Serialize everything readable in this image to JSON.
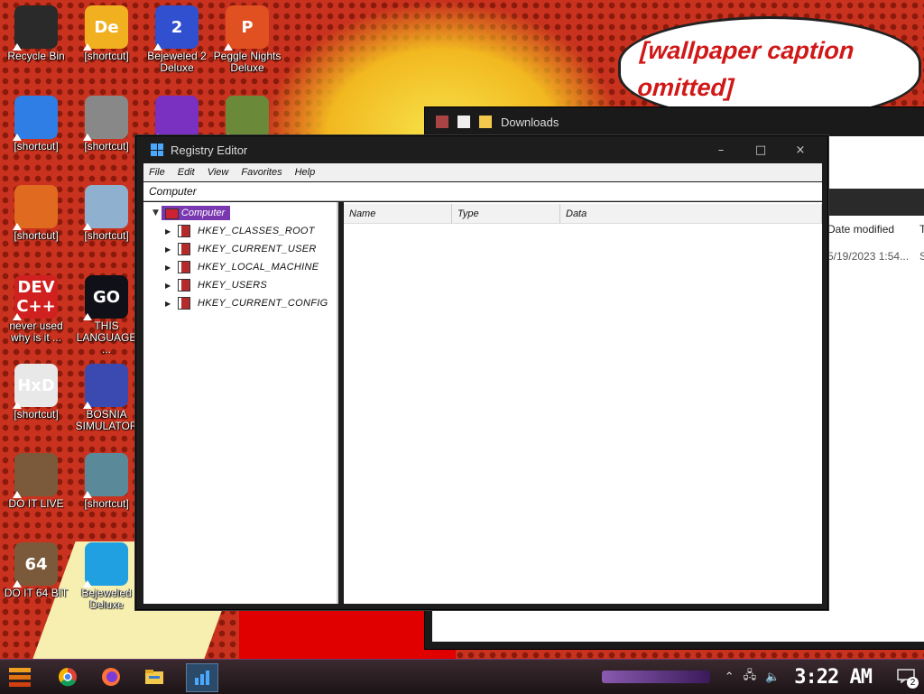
{
  "wallpaper": {
    "bubble_text": "[wallpaper caption omitted]"
  },
  "desktop_icons": [
    {
      "label": "Recycle Bin",
      "glyph": "",
      "color": "#2a2a2a",
      "icon": "recycle-bin-icon"
    },
    {
      "label": "[shortcut]",
      "glyph": "De",
      "color": "#f0b020",
      "icon": "app-de-icon"
    },
    {
      "label": "Bejeweled 2 Deluxe",
      "glyph": "2",
      "color": "#3050d0",
      "icon": "bejeweled-2-icon"
    },
    {
      "label": "Peggle Nights Deluxe",
      "glyph": "P",
      "color": "#e05020",
      "icon": "peggle-icon"
    },
    {
      "label": "[shortcut]",
      "glyph": "",
      "color": "#2f7ee6",
      "icon": "chrome-icon"
    },
    {
      "label": "[shortcut]",
      "glyph": "",
      "color": "#888888",
      "icon": "windows-shortcut-icon"
    },
    {
      "label": "",
      "glyph": "",
      "color": "#7a30c0",
      "icon": "gem-icon"
    },
    {
      "label": "",
      "glyph": "",
      "color": "#6a8a3a",
      "icon": "plants-icon"
    },
    {
      "label": "[shortcut]",
      "glyph": "",
      "color": "#e06a20",
      "icon": "firefox-icon"
    },
    {
      "label": "[shortcut]",
      "glyph": "",
      "color": "#90b0d0",
      "icon": "network-icon"
    },
    {
      "label": "never used why is it ...",
      "glyph": "DEV C++",
      "color": "#d02020",
      "icon": "devcpp-icon"
    },
    {
      "label": "THIS LANGUAGE ...",
      "glyph": "GO",
      "color": "#101018",
      "icon": "goland-icon"
    },
    {
      "label": "[shortcut]",
      "glyph": "HxD",
      "color": "#e8e8e8",
      "icon": "hxd-icon"
    },
    {
      "label": "BOSNIA SIMULATOR",
      "glyph": "",
      "color": "#3a4ab0",
      "icon": "mine-icon"
    },
    {
      "label": "DO IT LIVE",
      "glyph": "",
      "color": "#7a5a3a",
      "icon": "portrait-icon"
    },
    {
      "label": "[shortcut]",
      "glyph": "",
      "color": "#5a8a9a",
      "icon": "elf-icon"
    },
    {
      "label": "DO IT 64 BIT",
      "glyph": "64",
      "color": "#7a5a3a",
      "icon": "portrait-64-icon"
    },
    {
      "label": "Bejeweled Deluxe",
      "glyph": "",
      "color": "#20a0e0",
      "icon": "diamond-icon"
    }
  ],
  "explorer": {
    "title": "Downloads",
    "col_date": "Date modified",
    "col_type": "T",
    "row_date": "5/19/2023 1:54...",
    "row_type": "S"
  },
  "regedit": {
    "title": "Registry Editor",
    "buttons": {
      "minimize": "–",
      "maximize": "□",
      "close": "×"
    },
    "menu": [
      "File",
      "Edit",
      "View",
      "Favorites",
      "Help"
    ],
    "address": "Computer",
    "tree_root": "Computer",
    "hives": [
      "HKEY_CLASSES_ROOT",
      "HKEY_CURRENT_USER",
      "HKEY_LOCAL_MACHINE",
      "HKEY_USERS",
      "HKEY_CURRENT_CONFIG"
    ],
    "columns": [
      "Name",
      "Type",
      "Data"
    ]
  },
  "taskbar": {
    "clock": "3:22 AM",
    "notifications": "2",
    "apps": [
      "chrome-icon",
      "firefox-icon",
      "file-explorer-icon",
      "registry-editor-icon"
    ]
  }
}
